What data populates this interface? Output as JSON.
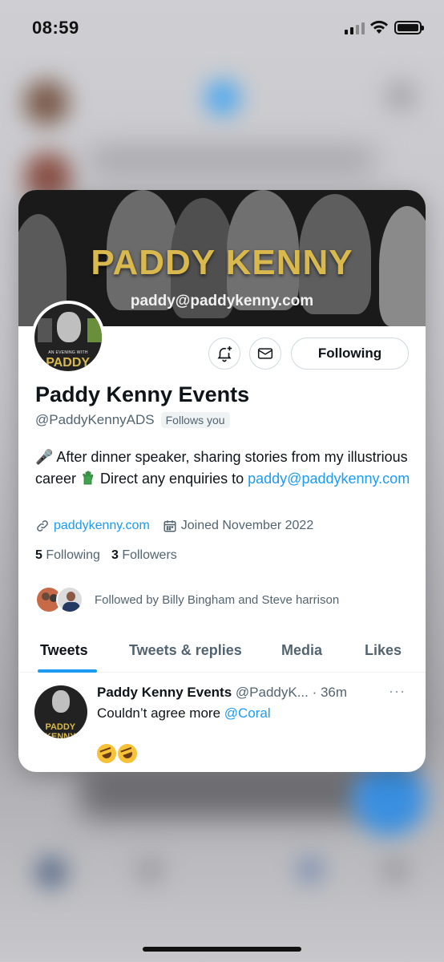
{
  "status_bar": {
    "time": "08:59"
  },
  "banner": {
    "title": "PADDY KENNY",
    "email": "paddy@paddykenny.com"
  },
  "avatar": {
    "caption": "AN EVENING WITH",
    "big": "PADDY KENNY"
  },
  "profile": {
    "name": "Paddy Kenny Events",
    "handle": "@PaddyKennyADS",
    "follows_you": "Follows you",
    "bio_part1": "🎤 After dinner speaker, sharing stories from my illustrious career ",
    "bio_part2": " Direct any enquiries to ",
    "bio_email": "paddy@paddykenny.com",
    "website": "paddykenny.com",
    "joined": "Joined November 2022",
    "following_count": "5",
    "following_label": "Following",
    "followers_count": "3",
    "followers_label": "Followers",
    "followed_by": "Followed by Billy Bingham and Steve harrison"
  },
  "buttons": {
    "follow_label": "Following"
  },
  "tabs": [
    {
      "label": "Tweets"
    },
    {
      "label": "Tweets & replies"
    },
    {
      "label": "Media"
    },
    {
      "label": "Likes"
    }
  ],
  "tweet": {
    "name": "Paddy Kenny Events",
    "handle_time": " @PaddyK... · 36m",
    "more": "···",
    "text_prefix": "Couldn’t agree more ",
    "mention": "@Coral"
  },
  "colors": {
    "accent": "#1d9bf0",
    "banner_gold": "#d9b94e"
  },
  "icons": [
    "notification-plus-icon",
    "mail-icon",
    "link-icon",
    "calendar-icon",
    "green-glove-emoji",
    "microphone-emoji",
    "rofl-emoji"
  ]
}
